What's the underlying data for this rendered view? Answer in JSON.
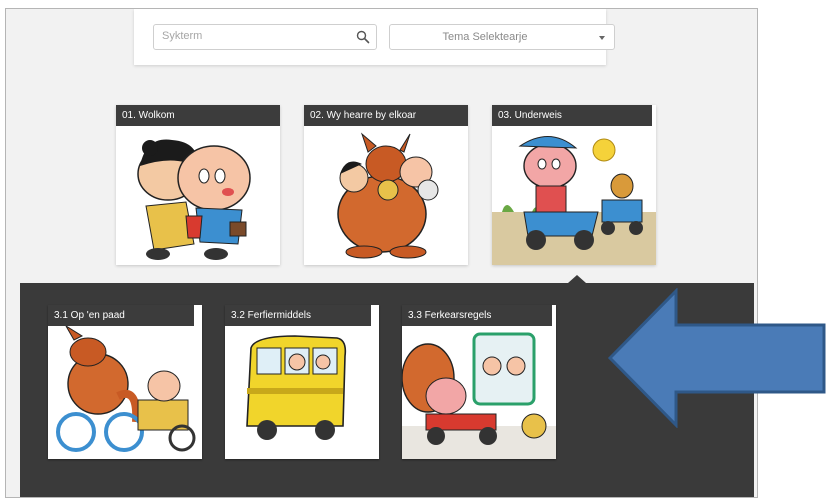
{
  "search": {
    "placeholder": "Sykterm",
    "icon": "search-icon"
  },
  "theme_select": {
    "selected": "Tema Selektearje",
    "icon": "caret-down-icon"
  },
  "topics": [
    {
      "label": "01. Wolkom"
    },
    {
      "label": "02. Wy hearre by elkoar"
    },
    {
      "label": "03. Underweis"
    }
  ],
  "subtopics": [
    {
      "label": "3.1 Op 'en paad"
    },
    {
      "label": "3.2 Ferfiermiddels"
    },
    {
      "label": "3.3 Ferkearsregels"
    }
  ],
  "colors": {
    "panel": "#3a3a3a",
    "title_bar": "#3c3c3c",
    "arrow_fill": "#4a7bb7",
    "arrow_stroke": "#2f5888"
  }
}
